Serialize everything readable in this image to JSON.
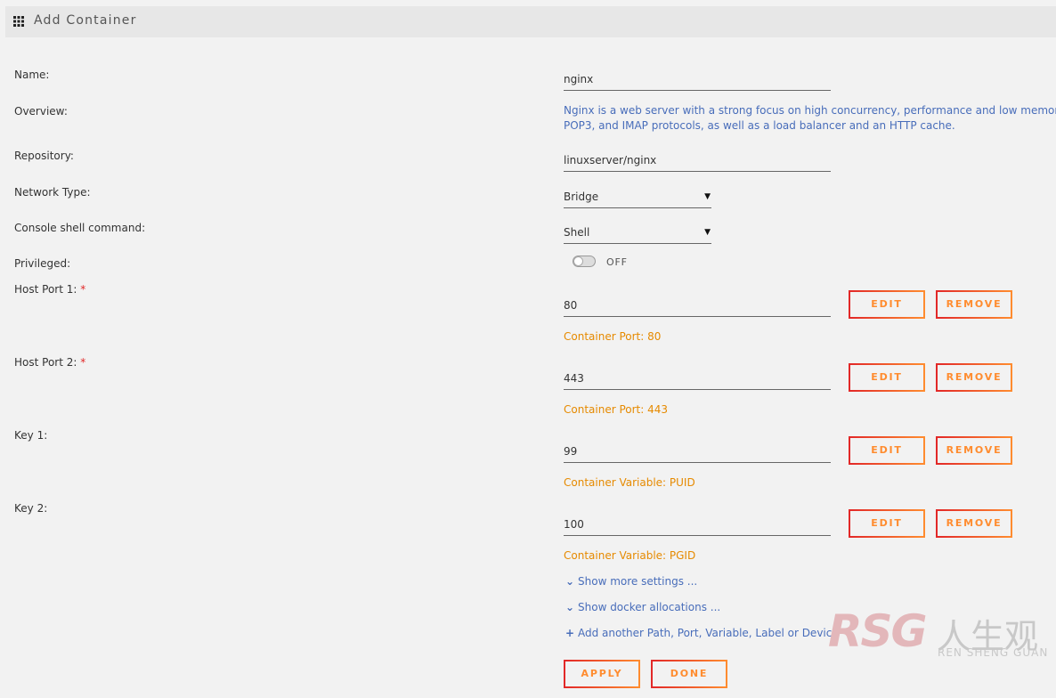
{
  "header": {
    "title": "Add Container",
    "icon": "grid-icon"
  },
  "form": {
    "name": {
      "label": "Name:",
      "value": "nginx"
    },
    "overview": {
      "label": "Overview:",
      "line1": "Nginx is a web server with a strong focus on high concurrency, performance and low memory u",
      "line2": "POP3, and IMAP protocols, as well as a load balancer and an HTTP cache."
    },
    "repository": {
      "label": "Repository:",
      "value": "linuxserver/nginx"
    },
    "network_type": {
      "label": "Network Type:",
      "value": "Bridge"
    },
    "console_shell": {
      "label": "Console shell command:",
      "value": "Shell"
    },
    "privileged": {
      "label": "Privileged:",
      "state": "OFF"
    },
    "host_port_1": {
      "label": "Host Port 1:",
      "required": "*",
      "value": "80",
      "hint": "Container Port: 80"
    },
    "host_port_2": {
      "label": "Host Port 2:",
      "required": "*",
      "value": "443",
      "hint": "Container Port: 443"
    },
    "key_1": {
      "label": "Key 1:",
      "value": "99",
      "hint": "Container Variable: PUID"
    },
    "key_2": {
      "label": "Key 2:",
      "value": "100",
      "hint": "Container Variable: PGID"
    }
  },
  "buttons": {
    "edit": "EDIT",
    "remove": "REMOVE",
    "apply": "APPLY",
    "done": "DONE"
  },
  "links": {
    "show_more": "Show more settings ...",
    "show_docker": "Show docker allocations ...",
    "add_another": "Add another Path, Port, Variable, Label or Device"
  },
  "watermark": {
    "logo": "RSG",
    "cn": "人生观",
    "pinyin": "REN SHENG GUAN"
  },
  "colors": {
    "accent": "#ff8c2f",
    "link": "#486dba",
    "hint": "#e68a00",
    "required": "#e22828"
  }
}
